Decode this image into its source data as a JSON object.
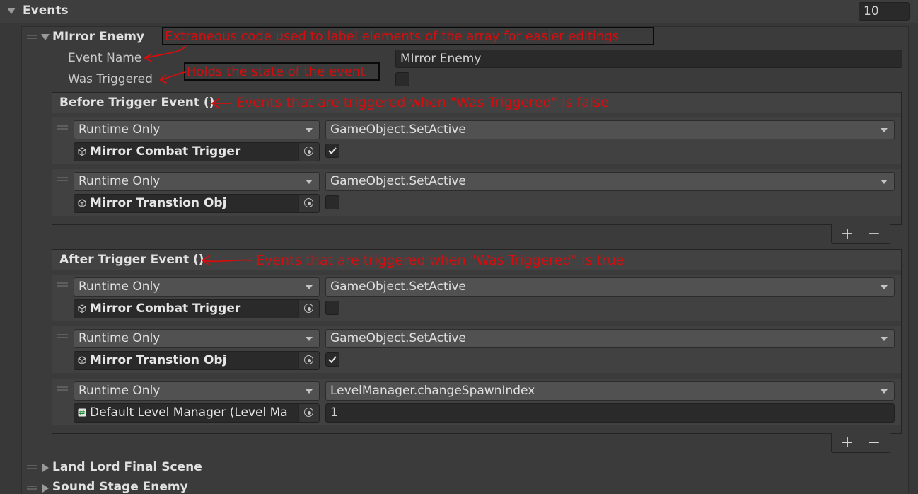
{
  "events_header": {
    "label": "Events",
    "count": "10"
  },
  "element": {
    "title": "MIrror Enemy",
    "event_name_label": "Event Name",
    "event_name_value": "MIrror Enemy",
    "was_triggered_label": "Was Triggered",
    "was_triggered": false
  },
  "before_trigger": {
    "title": "Before Trigger Event ()",
    "listeners": [
      {
        "mode": "Runtime Only",
        "function": "GameObject.SetActive",
        "target": "Mirror Combat Trigger",
        "target_icon": "cube-icon",
        "arg_checked": true
      },
      {
        "mode": "Runtime Only",
        "function": "GameObject.SetActive",
        "target": "Mirror Transtion Obj",
        "target_icon": "cube-icon",
        "arg_checked": false
      }
    ]
  },
  "after_trigger": {
    "title": "After Trigger Event ()",
    "listeners": [
      {
        "mode": "Runtime Only",
        "function": "GameObject.SetActive",
        "target": "Mirror Combat Trigger",
        "target_icon": "cube-icon",
        "arg_checked": false
      },
      {
        "mode": "Runtime Only",
        "function": "GameObject.SetActive",
        "target": "Mirror Transtion Obj",
        "target_icon": "cube-icon",
        "arg_checked": true
      },
      {
        "mode": "Runtime Only",
        "function": "LevelManager.changeSpawnIndex",
        "target": "Default Level Manager (Level Ma",
        "target_icon": "script-icon",
        "arg_value": "1"
      }
    ]
  },
  "footer_buttons": {
    "add": "+",
    "remove": "−"
  },
  "collapsed_elements": [
    "Land Lord Final Scene",
    "Sound Stage Enemy"
  ],
  "annotations": {
    "element_label": "Extraneous code used to label elements of the array for easier editings",
    "was_triggered": "Holds the state of the event",
    "before": "Events that are triggered when \"Was Triggered\" is false",
    "after": "Events that are triggered when \"Was Triggered\" is true"
  },
  "colors": {
    "background": "#383838",
    "field": "#2a2a2a",
    "dropdown": "#515151",
    "annotation": "#d40e0e"
  }
}
